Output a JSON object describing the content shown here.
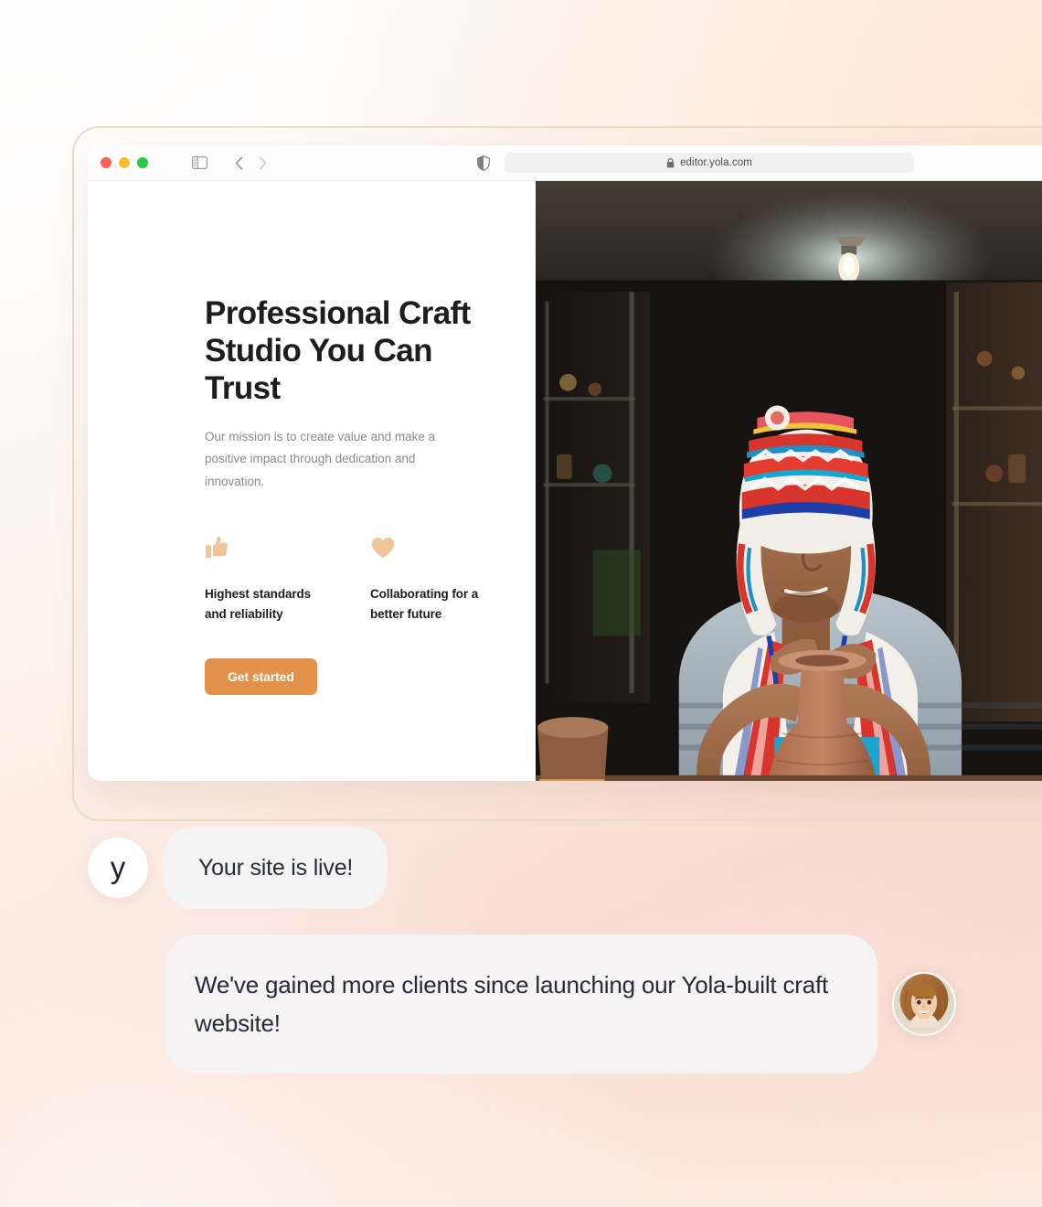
{
  "browser": {
    "url": "editor.yola.com",
    "lock_icon": "lock-icon",
    "traffic_lights": [
      "close-red",
      "minimize-yellow",
      "maximize-green"
    ],
    "controls": {
      "sidebar_toggle": "sidebar-toggle-icon",
      "back": "chevron-left-icon",
      "forward": "chevron-right-icon",
      "shield": "shield-icon",
      "reload": "reload-icon"
    }
  },
  "site": {
    "hero": {
      "title": "Professional Craft Studio You Can Trust",
      "subtitle": "Our mission is to create value and make a positive impact through dedication and innovation.",
      "cta_label": "Get started"
    },
    "features": [
      {
        "icon": "thumbs-up-icon",
        "label": "Highest standards and reliability"
      },
      {
        "icon": "heart-icon",
        "label": "Collaborating for a better future"
      }
    ],
    "photo_alt": "Artisan in traditional Andean chullo hat shaping clay on a pottery wheel"
  },
  "chat": {
    "messages": [
      {
        "avatar": "yola-logo-avatar",
        "avatar_letter": "y",
        "text": "Your site is live!"
      },
      {
        "avatar": "client-photo-avatar",
        "text": "We've gained more clients since launching our Yola-built craft website!"
      }
    ]
  },
  "colors": {
    "cta_orange": "#e3914a",
    "feature_icon_peach": "#f2c49c",
    "bubble_gray": "#f4f4f4",
    "frame_tan": "#eedcc4",
    "heading_dark": "#1d1d20",
    "body_gray": "#8b8b8f"
  }
}
